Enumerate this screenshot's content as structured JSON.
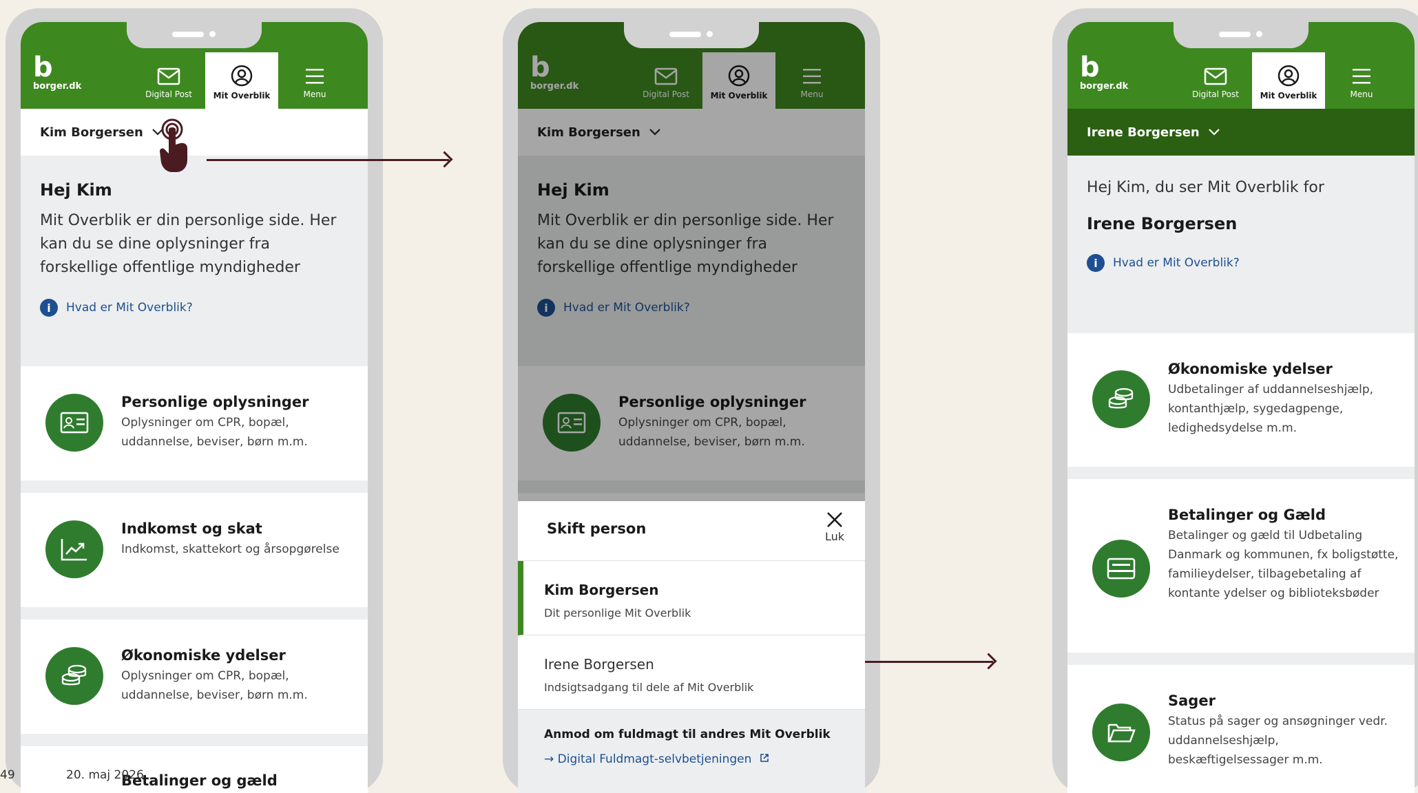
{
  "colors": {
    "brand_green": "#3e8820",
    "dark_green": "#2b5f12",
    "icon_green": "#2f7c2f",
    "link_blue": "#1d4f91",
    "arrow": "#4a1c22",
    "background": "#f4f0e8"
  },
  "header": {
    "logo_letter": "b",
    "logo_text": "borger.dk",
    "nav": [
      {
        "label": "Digital Post",
        "icon": "envelope-icon"
      },
      {
        "label": "Mit Overblik",
        "icon": "user-circle-icon"
      },
      {
        "label": "Menu",
        "icon": "hamburger-icon"
      }
    ]
  },
  "phone1": {
    "user_name": "Kim Borgersen",
    "greeting": "Hej Kim",
    "intro_text": "Mit Overblik er din personlige side. Her kan du se dine oplysninger fra forskellige offentlige myndigheder",
    "info_link": "Hvad er Mit Overblik?",
    "cards": [
      {
        "title": "Personlige oplysninger",
        "desc": "Oplysninger om CPR, bopæl, uddannelse, beviser, børn m.m.",
        "icon": "id-card-icon"
      },
      {
        "title": "Indkomst og skat",
        "desc": "Indkomst, skattekort og årsopgørelse",
        "icon": "chart-trend-icon"
      },
      {
        "title": "Økonomiske ydelser",
        "desc": "Oplysninger om CPR, bopæl, uddannelse, beviser, børn m.m.",
        "icon": "coins-icon"
      },
      {
        "title": "Betalinger og gæld",
        "desc": "",
        "icon": ""
      }
    ]
  },
  "phone2": {
    "sheet_title": "Skift person",
    "close_label": "Luk",
    "options": [
      {
        "name": "Kim Borgersen",
        "desc": "Dit personlige Mit Overblik"
      },
      {
        "name": "Irene Borgersen",
        "desc": "Indsigtsadgang til dele af Mit Overblik"
      }
    ],
    "footer_title": "Anmod om fuldmagt til andres Mit Overblik",
    "footer_link": "Digital Fuldmagt-selvbetjeningen"
  },
  "phone3": {
    "user_name": "Irene Borgersen",
    "intro_line": "Hej Kim, du ser Mit Overblik for",
    "viewed_name": "Irene Borgersen",
    "info_link": "Hvad er Mit Overblik?",
    "cards": [
      {
        "title": "Økonomiske ydelser",
        "desc": "Udbetalinger af uddannelseshjælp, kontanthjælp, sygedagpenge, ledighedsydelse m.m.",
        "icon": "coins-icon"
      },
      {
        "title": "Betalinger og Gæld",
        "desc": "Betalinger og gæld til Udbetaling Danmark og kommunen, fx boligstøtte, familieydelser, tilbagebetaling af kontante ydelser og biblioteksbøder",
        "icon": "credit-card-icon"
      },
      {
        "title": "Sager",
        "desc": "Status på sager og ansøgninger vedr. uddannelseshjælp, beskæftigelsessager m.m.",
        "icon": "folder-icon"
      }
    ]
  },
  "slide_footer": {
    "page_number": "49",
    "date": "20. maj 2026"
  }
}
